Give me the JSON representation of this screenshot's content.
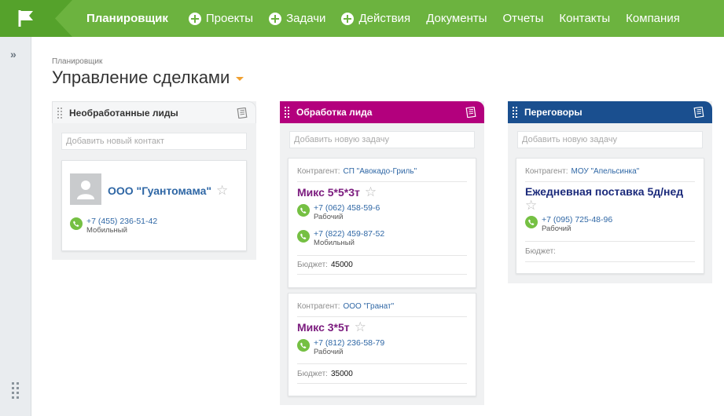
{
  "nav": {
    "active": "Планировщик",
    "items": [
      {
        "label": "Проекты",
        "plus": true
      },
      {
        "label": "Задачи",
        "plus": true
      },
      {
        "label": "Действия",
        "plus": true
      },
      {
        "label": "Документы",
        "plus": false
      },
      {
        "label": "Отчеты",
        "plus": false
      },
      {
        "label": "Контакты",
        "plus": false
      },
      {
        "label": "Компания",
        "plus": false
      }
    ]
  },
  "header": {
    "breadcrumb": "Планировщик",
    "title": "Управление сделками"
  },
  "colors": {
    "nav_green": "#6cb33f",
    "lead_header": "#b3007d",
    "negotiation_header": "#1a4f8f",
    "deal_purple": "#7b1b7e",
    "deal_navy": "#1b2a7b"
  },
  "columns": {
    "unprocessed": {
      "title": "Необработанные лиды",
      "add_placeholder": "Добавить новый контакт",
      "contact": {
        "name": "ООО \"Гуантомама\"",
        "phone": "+7 (455) 236-51-42",
        "phone_type": "Мобильный"
      }
    },
    "processing": {
      "title": "Обработка лида",
      "add_placeholder": "Добавить новую задачу",
      "cards": [
        {
          "contractor_label": "Контрагент:",
          "contractor": "СП \"Авокадо-Гриль\"",
          "title": "Микс 5*5*3т",
          "phones": [
            {
              "number": "+7 (062) 458-59-6",
              "type": "Рабочий"
            },
            {
              "number": "+7 (822) 459-87-52",
              "type": "Мобильный"
            }
          ],
          "budget_label": "Бюджет:",
          "budget": "45000"
        },
        {
          "contractor_label": "Контрагент:",
          "contractor": "ООО \"Гранат\"",
          "title": "Микс 3*5т",
          "phones": [
            {
              "number": "+7 (812) 236-58-79",
              "type": "Рабочий"
            }
          ],
          "budget_label": "Бюджет:",
          "budget": "35000"
        }
      ]
    },
    "negotiation": {
      "title": "Переговоры",
      "add_placeholder": "Добавить новую задачу",
      "card": {
        "contractor_label": "Контрагент:",
        "contractor": "МОУ \"Апельсинка\"",
        "title": "Ежедневная поставка 5д/нед",
        "phone": "+7 (095) 725-48-96",
        "phone_type": "Рабочий",
        "budget_label": "Бюджет:",
        "budget": ""
      }
    }
  }
}
